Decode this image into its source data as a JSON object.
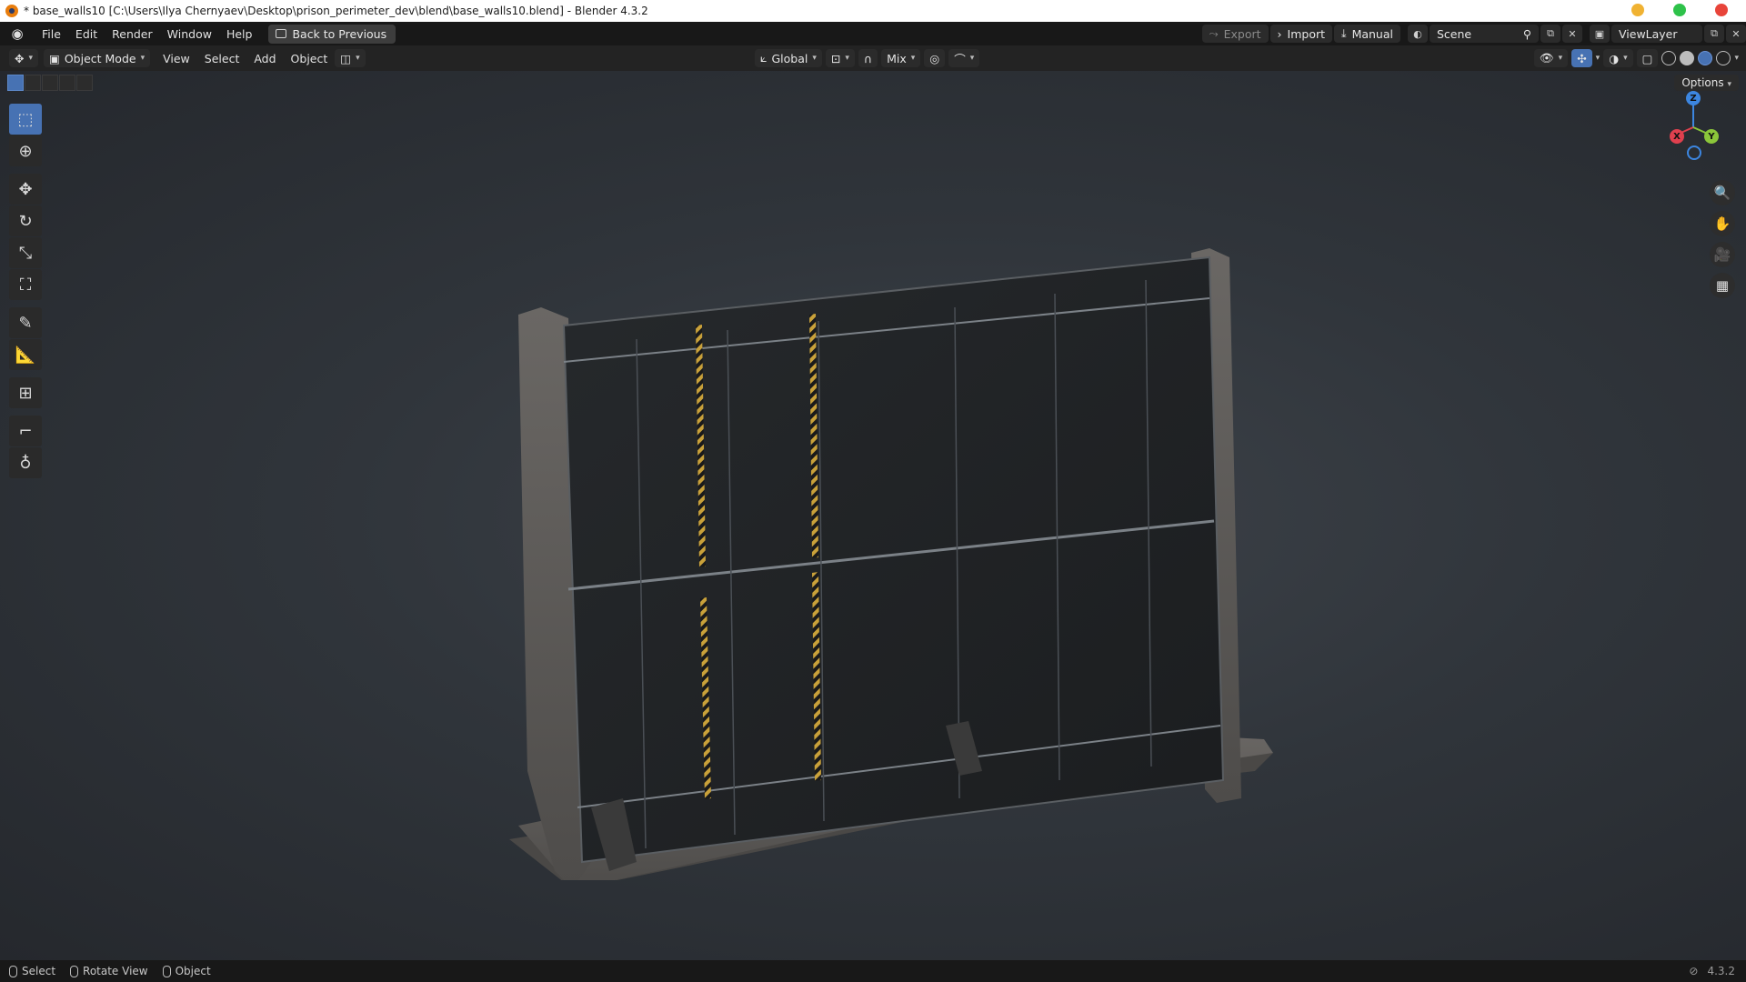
{
  "window": {
    "title": "* base_walls10 [C:\\Users\\Ilya Chernyaev\\Desktop\\prison_perimeter_dev\\blend\\base_walls10.blend] - Blender 4.3.2",
    "controls": {
      "minimize_color": "#f0b232",
      "maximize_color": "#2ec24a",
      "close_color": "#e8443a"
    }
  },
  "menubar": {
    "items": [
      "File",
      "Edit",
      "Render",
      "Window",
      "Help"
    ],
    "back_button": "Back to Previous",
    "export_label": "Export",
    "import_label": "Import",
    "manual_label": "Manual",
    "scene_value": "Scene",
    "viewlayer_value": "ViewLayer"
  },
  "header3d": {
    "mode": "Object Mode",
    "menus": [
      "View",
      "Select",
      "Add",
      "Object"
    ],
    "orientation": "Global",
    "snap_mode": "Mix"
  },
  "viewport": {
    "options_label": "Options",
    "gizmo": {
      "x": "X",
      "y": "Y",
      "z": "Z",
      "x_color": "#e0404e",
      "y_color": "#8bc63a",
      "z_color": "#3c86e0"
    },
    "accent_color": "#4772b3"
  },
  "statusbar": {
    "items": [
      "Select",
      "Rotate View",
      "Object"
    ],
    "version": "4.3.2"
  }
}
